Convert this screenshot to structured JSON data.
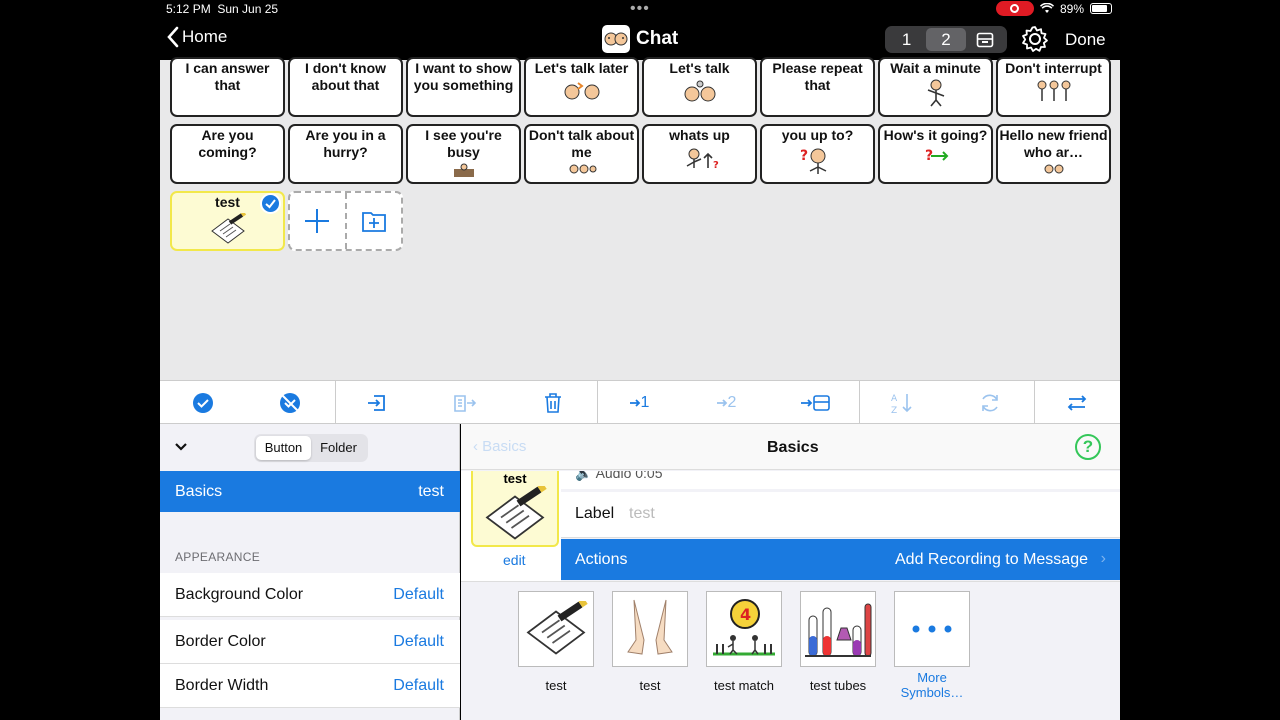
{
  "status": {
    "time": "5:12 PM",
    "date": "Sun Jun 25",
    "battery": "89%"
  },
  "nav": {
    "back_label": "Home",
    "title": "Chat",
    "pages": [
      "1",
      "2"
    ],
    "done_label": "Done"
  },
  "grid": {
    "row1": [
      "I can answer that",
      "I don't know about that",
      "I want to show you something",
      "Let's talk later",
      "Let's talk",
      "Please repeat that",
      "Wait a minute",
      "Don't interrupt"
    ],
    "row2": [
      "Are you coming?",
      "Are you in a hurry?",
      "I see you're busy",
      "Don't talk about me",
      "whats up",
      "you up to?",
      "How's it going?",
      "Hello new friend who ar…"
    ],
    "selected_label": "test"
  },
  "toolbar": {
    "page1": "1",
    "page2": "2"
  },
  "left_panel": {
    "seg_button": "Button",
    "seg_folder": "Folder",
    "basics_label": "Basics",
    "basics_value": "test",
    "section": "APPEARANCE",
    "rows": [
      {
        "label": "Background Color",
        "value": "Default"
      },
      {
        "label": "Border Color",
        "value": "Default"
      },
      {
        "label": "Border Width",
        "value": "Default"
      }
    ]
  },
  "right_panel": {
    "back_label": "Basics",
    "title": "Basics",
    "help": "?",
    "preview_label": "test",
    "edit_label": "edit",
    "audio_label": "Audio 0:05",
    "label_key": "Label",
    "label_placeholder": "test",
    "actions_label": "Actions",
    "actions_value": "Add Recording to Message",
    "symbols": [
      {
        "label": "test"
      },
      {
        "label": "test"
      },
      {
        "label": "test match"
      },
      {
        "label": "test tubes"
      },
      {
        "label": "More Symbols…"
      }
    ]
  },
  "colors": {
    "accent": "#1a7ae0",
    "selected_cell": "#fdfbd3",
    "help": "#34c759"
  }
}
